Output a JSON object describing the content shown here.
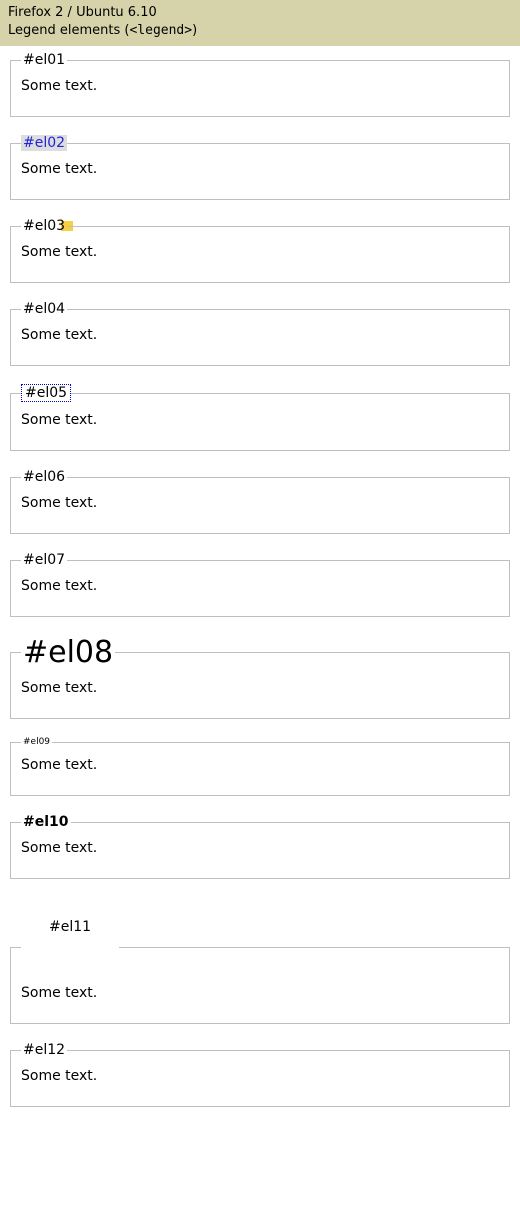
{
  "header": {
    "line1": "Firefox 2 / Ubuntu 6.10",
    "line2_prefix": "Legend elements (",
    "line2_mono": "<legend>",
    "line2_suffix": ")"
  },
  "body_text": "Some text.",
  "examples": [
    {
      "id": "el01",
      "legend": "#el01",
      "legend_class": "",
      "fs_class": ""
    },
    {
      "id": "el02",
      "legend": "#el02",
      "legend_class": "leg-el02",
      "fs_class": ""
    },
    {
      "id": "el03",
      "legend": "#el03",
      "legend_class": "leg-el03",
      "fs_class": ""
    },
    {
      "id": "el04",
      "legend": "#el04",
      "legend_class": "",
      "fs_class": ""
    },
    {
      "id": "el05",
      "legend": "#el05",
      "legend_class": "leg-el05",
      "fs_class": ""
    },
    {
      "id": "el06",
      "legend": "#el06",
      "legend_class": "",
      "fs_class": ""
    },
    {
      "id": "el07",
      "legend": "#el07",
      "legend_class": "",
      "fs_class": ""
    },
    {
      "id": "el08",
      "legend": "#el08",
      "legend_class": "leg-el08",
      "fs_class": ""
    },
    {
      "id": "el09",
      "legend": "#el09",
      "legend_class": "leg-el09",
      "fs_class": ""
    },
    {
      "id": "el10",
      "legend": "#el10",
      "legend_class": "leg-el10",
      "fs_class": ""
    },
    {
      "id": "el11",
      "legend": "#el11",
      "legend_class": "leg-el11",
      "fs_class": "fs-el11"
    },
    {
      "id": "el12",
      "legend": "#el12",
      "legend_class": "",
      "fs_class": ""
    }
  ]
}
